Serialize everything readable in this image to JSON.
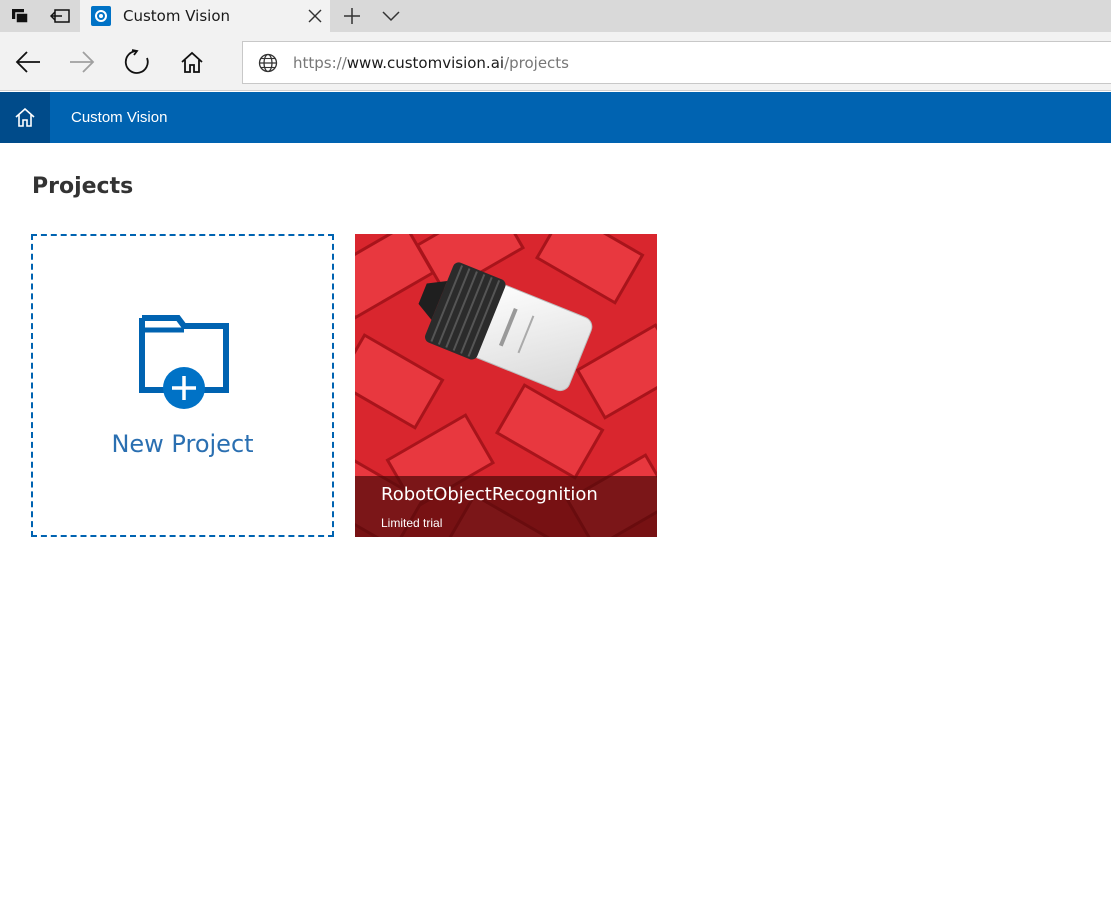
{
  "browser": {
    "tab": {
      "title": "Custom Vision"
    },
    "address": {
      "scheme": "https://",
      "host": "www.customvision.ai",
      "path": "/projects"
    },
    "icons": [
      "tabs-icon",
      "set-aside-icon",
      "favicon-icon",
      "close-icon",
      "plus-icon",
      "chevron-down-icon",
      "back-icon",
      "forward-icon",
      "refresh-icon",
      "home-icon",
      "globe-icon"
    ]
  },
  "app": {
    "title": "Custom Vision",
    "accent": "#0063b1",
    "home_bg": "#004b8a"
  },
  "main": {
    "title": "Projects",
    "new_project": {
      "label": "New Project",
      "icon": "new-folder-icon"
    },
    "projects": [
      {
        "name": "RobotObjectRecognition",
        "subtitle": "Limited trial"
      }
    ]
  }
}
